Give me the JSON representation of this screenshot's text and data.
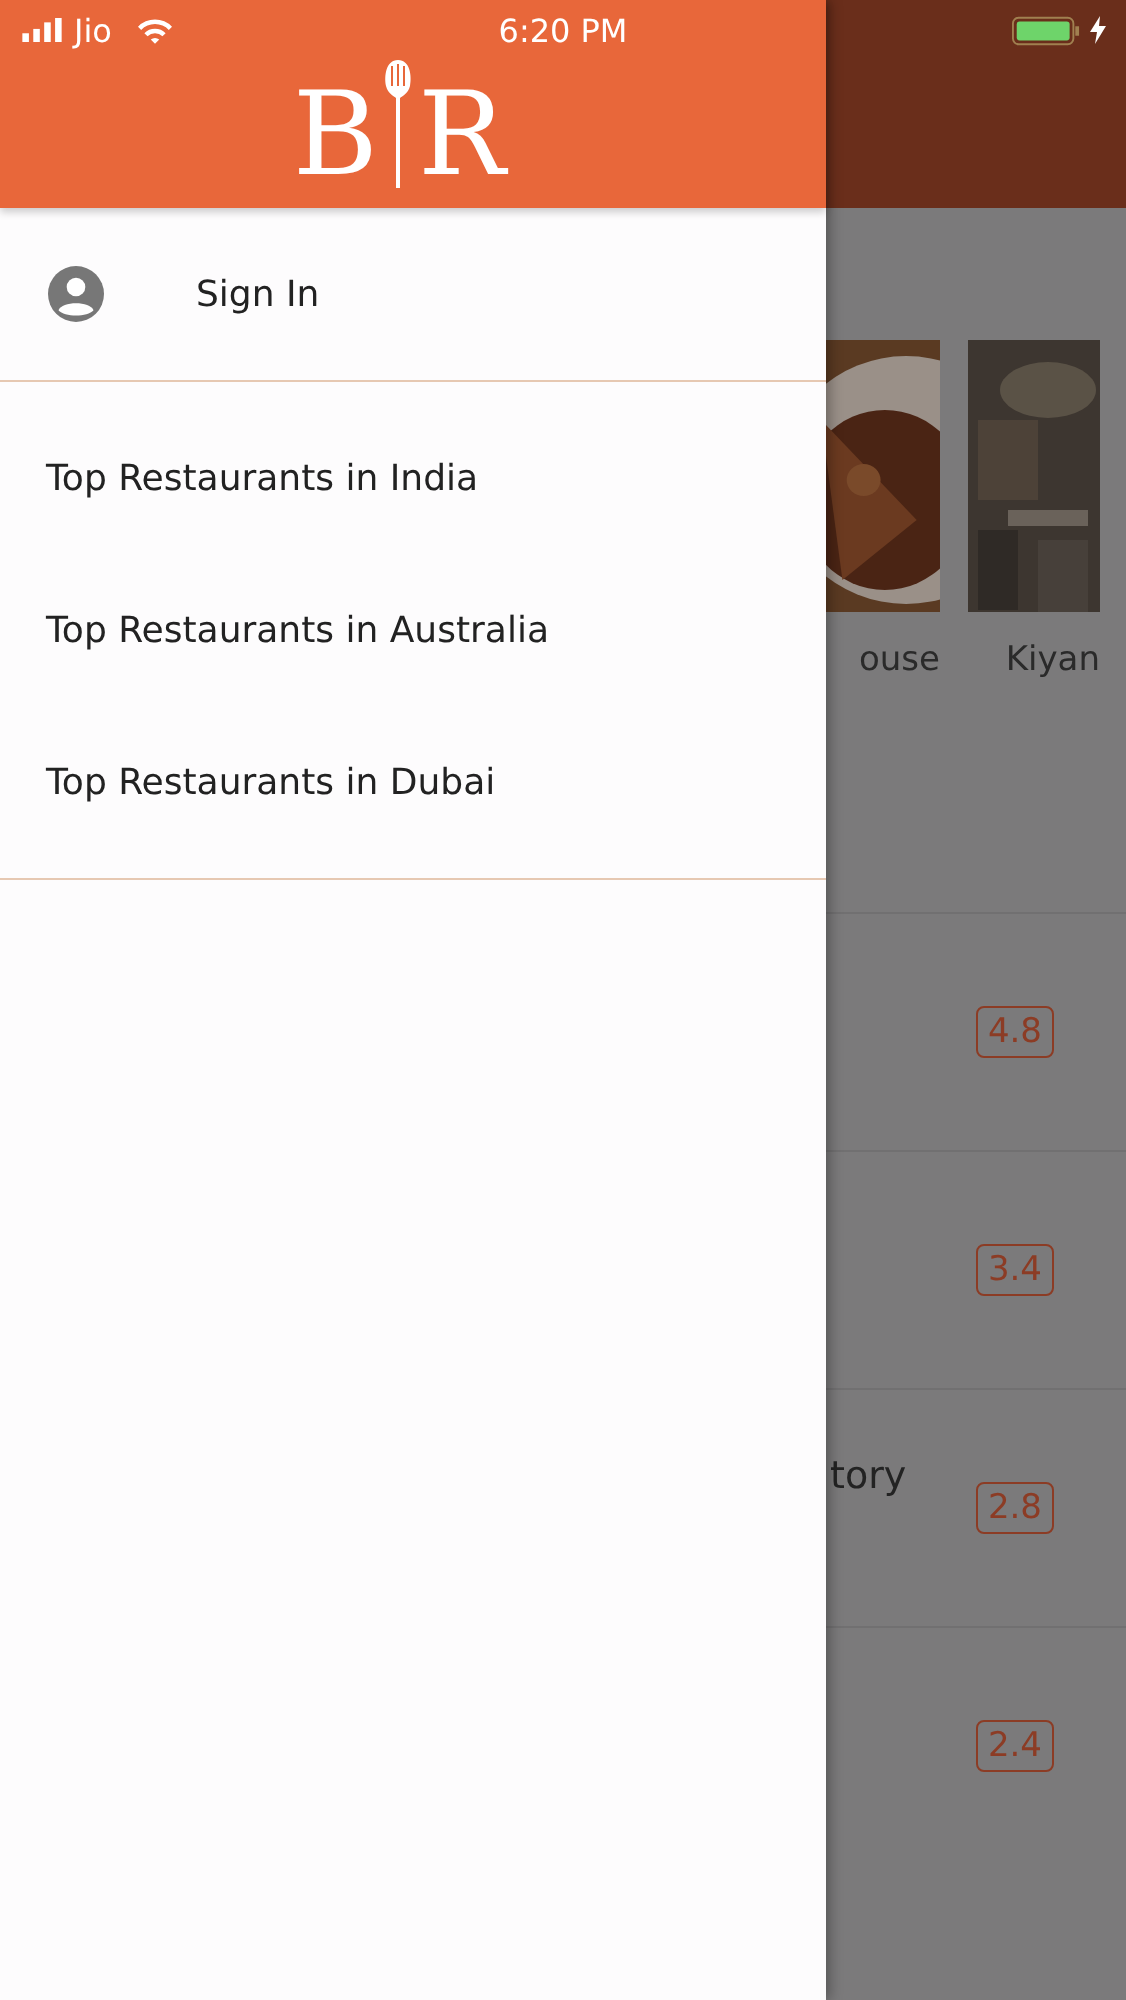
{
  "status_bar": {
    "carrier": "Jio",
    "time": "6:20 PM",
    "charging": true
  },
  "drawer": {
    "logo": {
      "left": "B",
      "right": "R"
    },
    "sign_in": "Sign In",
    "items": [
      {
        "label": "Top Restaurants in India"
      },
      {
        "label": "Top Restaurants in Australia"
      },
      {
        "label": "Top Restaurants in Dubai"
      }
    ]
  },
  "background": {
    "cards": [
      {
        "name": "ouse",
        "kind": "picture"
      },
      {
        "name": "Kiyan",
        "kind": "picture"
      }
    ],
    "list": [
      {
        "rating": "4.8"
      },
      {
        "rating": "3.4"
      },
      {
        "name": "tory",
        "rating": "2.8"
      },
      {
        "rating": "2.4"
      }
    ]
  }
}
